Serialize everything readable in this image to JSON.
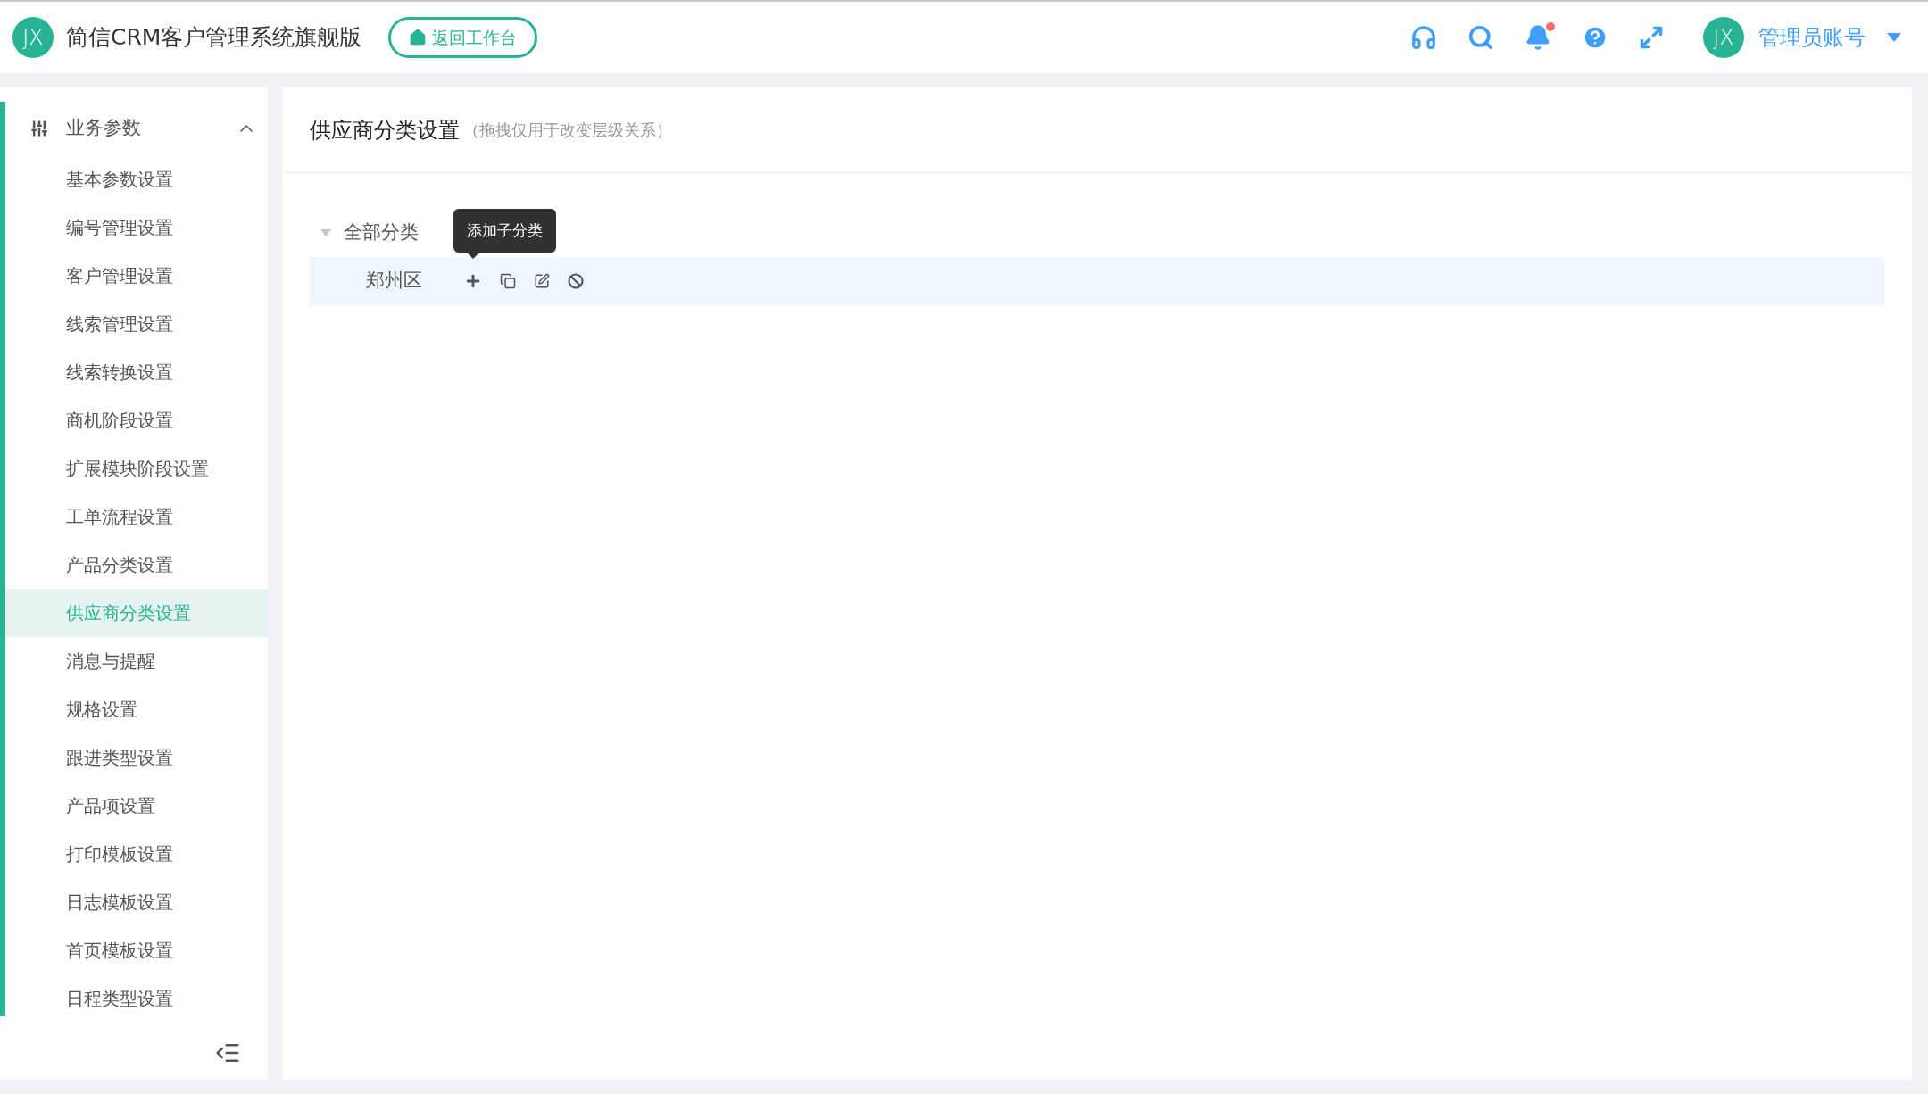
{
  "header": {
    "logo_text": "JX",
    "app_title": "简信CRM客户管理系统旗舰版",
    "back_button": "返回工作台",
    "notifications_unread": true,
    "user": {
      "avatar_text": "JX",
      "name": "管理员账号"
    }
  },
  "sidebar": {
    "group": {
      "label": "业务参数",
      "expanded": true
    },
    "items": [
      {
        "label": "基本参数设置",
        "selected": false
      },
      {
        "label": "编号管理设置",
        "selected": false
      },
      {
        "label": "客户管理设置",
        "selected": false
      },
      {
        "label": "线索管理设置",
        "selected": false
      },
      {
        "label": "线索转换设置",
        "selected": false
      },
      {
        "label": "商机阶段设置",
        "selected": false
      },
      {
        "label": "扩展模块阶段设置",
        "selected": false
      },
      {
        "label": "工单流程设置",
        "selected": false
      },
      {
        "label": "产品分类设置",
        "selected": false
      },
      {
        "label": "供应商分类设置",
        "selected": true
      },
      {
        "label": "消息与提醒",
        "selected": false
      },
      {
        "label": "规格设置",
        "selected": false
      },
      {
        "label": "跟进类型设置",
        "selected": false
      },
      {
        "label": "产品项设置",
        "selected": false
      },
      {
        "label": "打印模板设置",
        "selected": false
      },
      {
        "label": "日志模板设置",
        "selected": false
      },
      {
        "label": "首页模板设置",
        "selected": false
      },
      {
        "label": "日程类型设置",
        "selected": false
      }
    ]
  },
  "panel": {
    "title": "供应商分类设置",
    "hint": "（拖拽仅用于改变层级关系）",
    "tree": [
      {
        "label": "全部分类",
        "expanded": true,
        "selected": false,
        "children": [
          {
            "label": "郑州区",
            "selected": true
          }
        ]
      }
    ],
    "tooltip": "添加子分类"
  }
}
